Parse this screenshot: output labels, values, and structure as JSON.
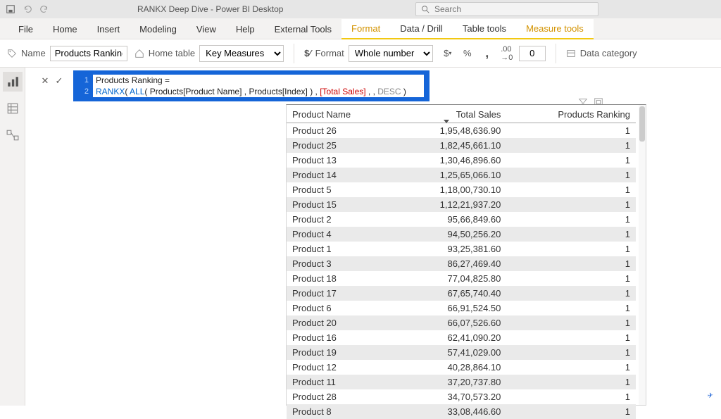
{
  "title": "RANKX Deep Dive - Power BI Desktop",
  "search_placeholder": "Search",
  "ribbon_tabs": [
    "File",
    "Home",
    "Insert",
    "Modeling",
    "View",
    "Help",
    "External Tools",
    "Format",
    "Data / Drill",
    "Table tools",
    "Measure tools"
  ],
  "name_label": "Name",
  "name_value": "Products Ranking",
  "home_table_label": "Home table",
  "home_table_value": "Key Measures",
  "format_label": "Format",
  "format_value": "Whole number",
  "decimals_value": "0",
  "data_category_label": "Data category",
  "formula": {
    "line1": "Products Ranking =",
    "line2_pre": "RANKX",
    "line2_all": "ALL",
    "line2_col1": "Products[Product Name]",
    "line2_col2": "Products[Index]",
    "line2_meas": "[Total Sales]",
    "line2_desc": "DESC"
  },
  "table": {
    "headers": [
      "Product Name",
      "Total Sales",
      "Products Ranking"
    ],
    "rows": [
      [
        "Product 26",
        "1,95,48,636.90",
        "1"
      ],
      [
        "Product 25",
        "1,82,45,661.10",
        "1"
      ],
      [
        "Product 13",
        "1,30,46,896.60",
        "1"
      ],
      [
        "Product 14",
        "1,25,65,066.10",
        "1"
      ],
      [
        "Product 5",
        "1,18,00,730.10",
        "1"
      ],
      [
        "Product 15",
        "1,12,21,937.20",
        "1"
      ],
      [
        "Product 2",
        "95,66,849.60",
        "1"
      ],
      [
        "Product 4",
        "94,50,256.20",
        "1"
      ],
      [
        "Product 1",
        "93,25,381.60",
        "1"
      ],
      [
        "Product 3",
        "86,27,469.40",
        "1"
      ],
      [
        "Product 18",
        "77,04,825.80",
        "1"
      ],
      [
        "Product 17",
        "67,65,740.40",
        "1"
      ],
      [
        "Product 6",
        "66,91,524.50",
        "1"
      ],
      [
        "Product 20",
        "66,07,526.60",
        "1"
      ],
      [
        "Product 16",
        "62,41,090.20",
        "1"
      ],
      [
        "Product 19",
        "57,41,029.00",
        "1"
      ],
      [
        "Product 12",
        "40,28,864.10",
        "1"
      ],
      [
        "Product 11",
        "37,20,737.80",
        "1"
      ],
      [
        "Product 28",
        "34,70,573.20",
        "1"
      ],
      [
        "Product 8",
        "33,08,446.60",
        "1"
      ]
    ]
  }
}
